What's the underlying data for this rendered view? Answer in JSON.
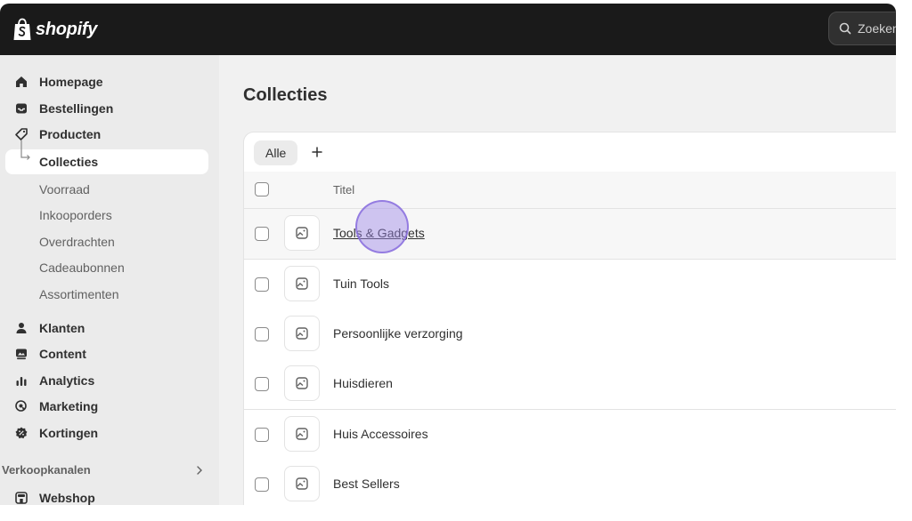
{
  "app": {
    "logo_text": "shopify"
  },
  "search": {
    "placeholder": "Zoeken"
  },
  "sidebar": {
    "items": [
      {
        "label": "Homepage"
      },
      {
        "label": "Bestellingen"
      },
      {
        "label": "Producten"
      },
      {
        "label": "Collecties"
      },
      {
        "label": "Voorraad"
      },
      {
        "label": "Inkooporders"
      },
      {
        "label": "Overdrachten"
      },
      {
        "label": "Cadeaubonnen"
      },
      {
        "label": "Assortimenten"
      },
      {
        "label": "Klanten"
      },
      {
        "label": "Content"
      },
      {
        "label": "Analytics"
      },
      {
        "label": "Marketing"
      },
      {
        "label": "Kortingen"
      }
    ],
    "section": {
      "label": "Verkoopkanalen"
    },
    "channels": [
      {
        "label": "Webshop"
      }
    ]
  },
  "main": {
    "title": "Collecties",
    "tabs": {
      "all_label": "Alle",
      "add_label": "+"
    },
    "table": {
      "header_title": "Titel",
      "rows": [
        {
          "title": "Tools & Gadgets"
        },
        {
          "title": "Tuin Tools"
        },
        {
          "title": "Persoonlijke verzorging"
        },
        {
          "title": "Huisdieren"
        },
        {
          "title": "Huis Accessoires"
        },
        {
          "title": "Best Sellers"
        }
      ]
    }
  },
  "colors": {
    "topbar": "#1a1a1a",
    "sidebar_bg": "#ebebeb",
    "content_bg": "#f1f1f1",
    "card_bg": "#ffffff",
    "text_primary": "#303030",
    "text_secondary": "#616161",
    "cursor_highlight": "#9c84e6"
  }
}
